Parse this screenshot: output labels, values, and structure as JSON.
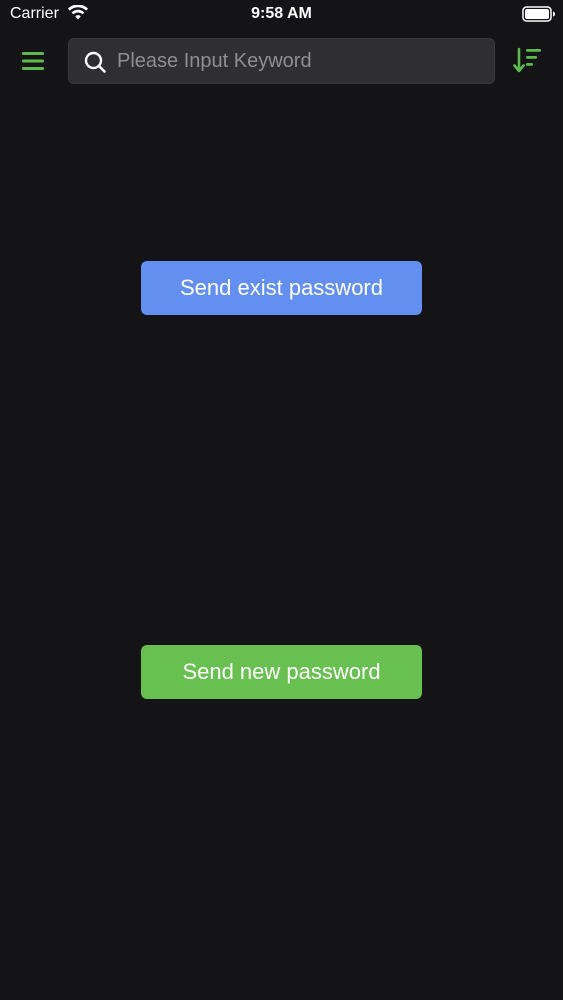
{
  "status_bar": {
    "carrier": "Carrier",
    "time": "9:58 AM"
  },
  "toolbar": {
    "menu_icon": "hamburger-menu-icon",
    "search": {
      "icon": "search-icon",
      "placeholder": "Please Input Keyword",
      "value": ""
    },
    "sort_icon": "sort-descending-icon"
  },
  "actions": {
    "send_exist_label": "Send exist password",
    "send_new_label": "Send new password"
  },
  "colors": {
    "background": "#141416",
    "accent_green": "#5dbb4b",
    "button_blue": "#6390f0",
    "button_green": "#67c04f"
  }
}
